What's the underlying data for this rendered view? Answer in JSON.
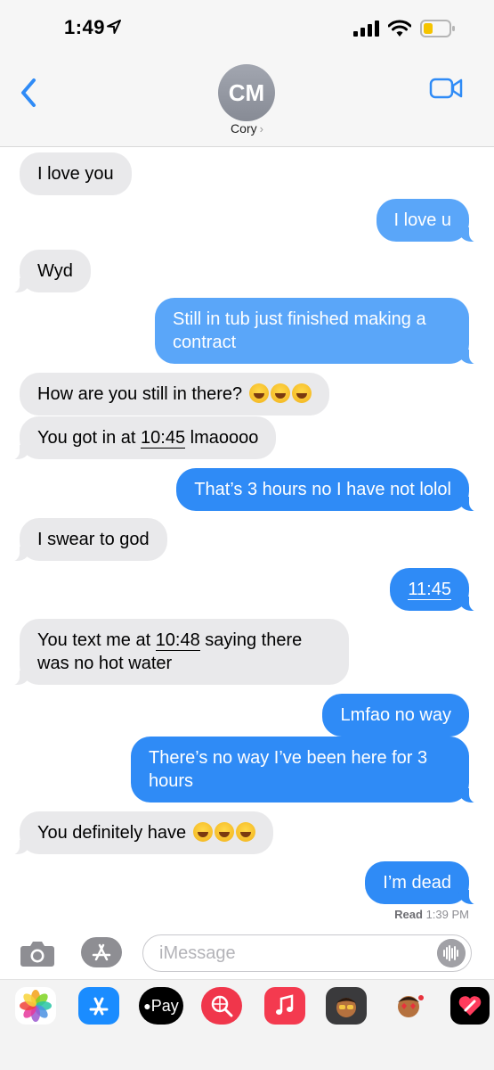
{
  "status_bar": {
    "time": "1:49"
  },
  "header": {
    "avatar_initials": "CM",
    "contact_name": "Cory"
  },
  "messages": [
    {
      "from": "them",
      "text": "I love you"
    },
    {
      "from": "me",
      "text": "I love u"
    },
    {
      "from": "them",
      "text": "Wyd"
    },
    {
      "from": "me",
      "text": "Still in tub just finished making a contract"
    },
    {
      "from": "them",
      "text": "How are you still in there?",
      "emoji": "😂😂😂"
    },
    {
      "from": "them",
      "pre": "You got in at ",
      "link": "10:45",
      "post": " lmaoooo"
    },
    {
      "from": "me",
      "text": "That’s 3 hours no I have not lolol"
    },
    {
      "from": "them",
      "text": "I swear to god"
    },
    {
      "from": "me",
      "link": "11:45"
    },
    {
      "from": "them",
      "pre": "You text me at ",
      "link": "10:48",
      "post": " saying there was no hot water"
    },
    {
      "from": "me",
      "text": "Lmfao no way"
    },
    {
      "from": "me",
      "text": "There’s no way I’ve been here for 3 hours"
    },
    {
      "from": "them",
      "text": "You definitely have",
      "emoji": "😂😂😂"
    },
    {
      "from": "me",
      "text": "I’m dead"
    }
  ],
  "read_receipt": {
    "label": "Read",
    "time": "1:39 PM"
  },
  "composer": {
    "placeholder": "iMessage"
  },
  "app_drawer": [
    {
      "name": "photos-app-icon",
      "icon": "photos",
      "color": "#ffffff"
    },
    {
      "name": "app-store-app-icon",
      "icon": "app-store",
      "color": "#1a8cff"
    },
    {
      "name": "apple-pay-app-icon",
      "icon": "apple-pay",
      "color": "#000000",
      "label": "Pay"
    },
    {
      "name": "image-search-app-icon",
      "icon": "globe-search",
      "color": "#f0364b"
    },
    {
      "name": "music-app-icon",
      "icon": "music",
      "color": "#f43a4f"
    },
    {
      "name": "memoji-app-icon",
      "icon": "memoji",
      "color": "#3a3a3c"
    },
    {
      "name": "memoji-stickers-app-icon",
      "icon": "memoji-stickers",
      "color": "#f3f3f3"
    },
    {
      "name": "digital-touch-app-icon",
      "icon": "heart",
      "color": "#000000"
    }
  ]
}
